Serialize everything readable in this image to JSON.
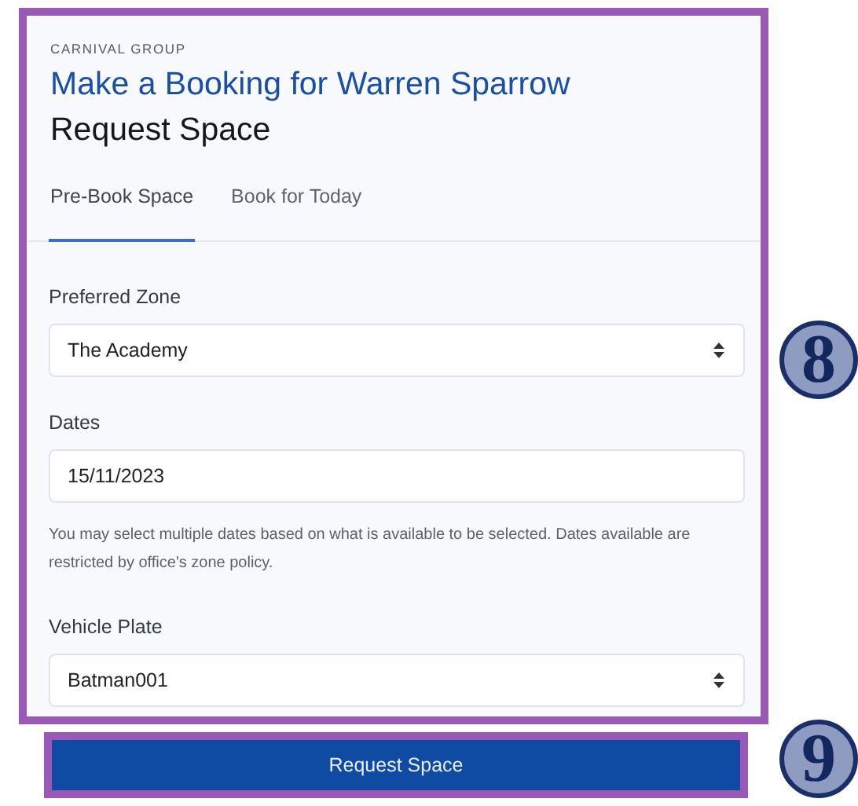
{
  "header": {
    "organization": "CARNIVAL GROUP",
    "title": "Make a Booking for Warren Sparrow",
    "subtitle": "Request Space"
  },
  "tabs": [
    {
      "label": "Pre-Book Space",
      "selected": true
    },
    {
      "label": "Book for Today",
      "selected": false
    }
  ],
  "fields": [
    {
      "kind": "select",
      "label": "Preferred Zone",
      "value": "The Academy"
    },
    {
      "kind": "input",
      "label": "Dates",
      "value": "15/11/2023",
      "help": "You may select multiple dates based on what is available to be selected. Dates available are restricted by office's zone policy."
    },
    {
      "kind": "select",
      "label": "Vehicle Plate",
      "value": "Batman001"
    }
  ],
  "submit_button": "Request Space",
  "callouts": [
    "8",
    "9"
  ]
}
